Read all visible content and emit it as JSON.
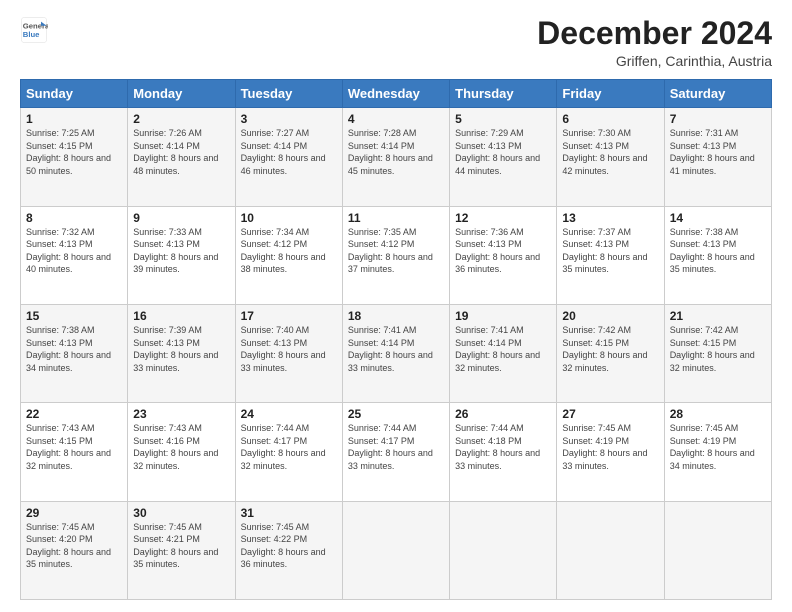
{
  "logo": {
    "line1": "General",
    "line2": "Blue"
  },
  "title": "December 2024",
  "subtitle": "Griffen, Carinthia, Austria",
  "days_header": [
    "Sunday",
    "Monday",
    "Tuesday",
    "Wednesday",
    "Thursday",
    "Friday",
    "Saturday"
  ],
  "weeks": [
    [
      {
        "day": "1",
        "sunrise": "Sunrise: 7:25 AM",
        "sunset": "Sunset: 4:15 PM",
        "daylight": "Daylight: 8 hours and 50 minutes."
      },
      {
        "day": "2",
        "sunrise": "Sunrise: 7:26 AM",
        "sunset": "Sunset: 4:14 PM",
        "daylight": "Daylight: 8 hours and 48 minutes."
      },
      {
        "day": "3",
        "sunrise": "Sunrise: 7:27 AM",
        "sunset": "Sunset: 4:14 PM",
        "daylight": "Daylight: 8 hours and 46 minutes."
      },
      {
        "day": "4",
        "sunrise": "Sunrise: 7:28 AM",
        "sunset": "Sunset: 4:14 PM",
        "daylight": "Daylight: 8 hours and 45 minutes."
      },
      {
        "day": "5",
        "sunrise": "Sunrise: 7:29 AM",
        "sunset": "Sunset: 4:13 PM",
        "daylight": "Daylight: 8 hours and 44 minutes."
      },
      {
        "day": "6",
        "sunrise": "Sunrise: 7:30 AM",
        "sunset": "Sunset: 4:13 PM",
        "daylight": "Daylight: 8 hours and 42 minutes."
      },
      {
        "day": "7",
        "sunrise": "Sunrise: 7:31 AM",
        "sunset": "Sunset: 4:13 PM",
        "daylight": "Daylight: 8 hours and 41 minutes."
      }
    ],
    [
      {
        "day": "8",
        "sunrise": "Sunrise: 7:32 AM",
        "sunset": "Sunset: 4:13 PM",
        "daylight": "Daylight: 8 hours and 40 minutes."
      },
      {
        "day": "9",
        "sunrise": "Sunrise: 7:33 AM",
        "sunset": "Sunset: 4:13 PM",
        "daylight": "Daylight: 8 hours and 39 minutes."
      },
      {
        "day": "10",
        "sunrise": "Sunrise: 7:34 AM",
        "sunset": "Sunset: 4:12 PM",
        "daylight": "Daylight: 8 hours and 38 minutes."
      },
      {
        "day": "11",
        "sunrise": "Sunrise: 7:35 AM",
        "sunset": "Sunset: 4:12 PM",
        "daylight": "Daylight: 8 hours and 37 minutes."
      },
      {
        "day": "12",
        "sunrise": "Sunrise: 7:36 AM",
        "sunset": "Sunset: 4:13 PM",
        "daylight": "Daylight: 8 hours and 36 minutes."
      },
      {
        "day": "13",
        "sunrise": "Sunrise: 7:37 AM",
        "sunset": "Sunset: 4:13 PM",
        "daylight": "Daylight: 8 hours and 35 minutes."
      },
      {
        "day": "14",
        "sunrise": "Sunrise: 7:38 AM",
        "sunset": "Sunset: 4:13 PM",
        "daylight": "Daylight: 8 hours and 35 minutes."
      }
    ],
    [
      {
        "day": "15",
        "sunrise": "Sunrise: 7:38 AM",
        "sunset": "Sunset: 4:13 PM",
        "daylight": "Daylight: 8 hours and 34 minutes."
      },
      {
        "day": "16",
        "sunrise": "Sunrise: 7:39 AM",
        "sunset": "Sunset: 4:13 PM",
        "daylight": "Daylight: 8 hours and 33 minutes."
      },
      {
        "day": "17",
        "sunrise": "Sunrise: 7:40 AM",
        "sunset": "Sunset: 4:13 PM",
        "daylight": "Daylight: 8 hours and 33 minutes."
      },
      {
        "day": "18",
        "sunrise": "Sunrise: 7:41 AM",
        "sunset": "Sunset: 4:14 PM",
        "daylight": "Daylight: 8 hours and 33 minutes."
      },
      {
        "day": "19",
        "sunrise": "Sunrise: 7:41 AM",
        "sunset": "Sunset: 4:14 PM",
        "daylight": "Daylight: 8 hours and 32 minutes."
      },
      {
        "day": "20",
        "sunrise": "Sunrise: 7:42 AM",
        "sunset": "Sunset: 4:15 PM",
        "daylight": "Daylight: 8 hours and 32 minutes."
      },
      {
        "day": "21",
        "sunrise": "Sunrise: 7:42 AM",
        "sunset": "Sunset: 4:15 PM",
        "daylight": "Daylight: 8 hours and 32 minutes."
      }
    ],
    [
      {
        "day": "22",
        "sunrise": "Sunrise: 7:43 AM",
        "sunset": "Sunset: 4:15 PM",
        "daylight": "Daylight: 8 hours and 32 minutes."
      },
      {
        "day": "23",
        "sunrise": "Sunrise: 7:43 AM",
        "sunset": "Sunset: 4:16 PM",
        "daylight": "Daylight: 8 hours and 32 minutes."
      },
      {
        "day": "24",
        "sunrise": "Sunrise: 7:44 AM",
        "sunset": "Sunset: 4:17 PM",
        "daylight": "Daylight: 8 hours and 32 minutes."
      },
      {
        "day": "25",
        "sunrise": "Sunrise: 7:44 AM",
        "sunset": "Sunset: 4:17 PM",
        "daylight": "Daylight: 8 hours and 33 minutes."
      },
      {
        "day": "26",
        "sunrise": "Sunrise: 7:44 AM",
        "sunset": "Sunset: 4:18 PM",
        "daylight": "Daylight: 8 hours and 33 minutes."
      },
      {
        "day": "27",
        "sunrise": "Sunrise: 7:45 AM",
        "sunset": "Sunset: 4:19 PM",
        "daylight": "Daylight: 8 hours and 33 minutes."
      },
      {
        "day": "28",
        "sunrise": "Sunrise: 7:45 AM",
        "sunset": "Sunset: 4:19 PM",
        "daylight": "Daylight: 8 hours and 34 minutes."
      }
    ],
    [
      {
        "day": "29",
        "sunrise": "Sunrise: 7:45 AM",
        "sunset": "Sunset: 4:20 PM",
        "daylight": "Daylight: 8 hours and 35 minutes."
      },
      {
        "day": "30",
        "sunrise": "Sunrise: 7:45 AM",
        "sunset": "Sunset: 4:21 PM",
        "daylight": "Daylight: 8 hours and 35 minutes."
      },
      {
        "day": "31",
        "sunrise": "Sunrise: 7:45 AM",
        "sunset": "Sunset: 4:22 PM",
        "daylight": "Daylight: 8 hours and 36 minutes."
      },
      null,
      null,
      null,
      null
    ]
  ]
}
